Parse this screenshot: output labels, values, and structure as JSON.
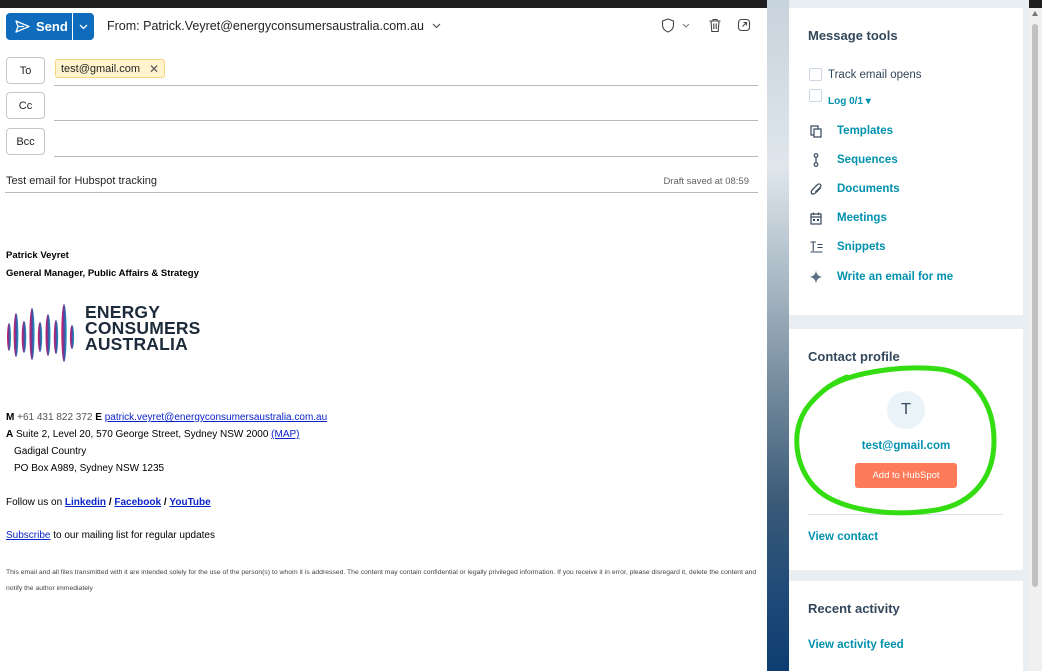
{
  "toolbar": {
    "send_label": "Send",
    "from_label": "From: Patrick.Veyret@energyconsumersaustralia.com.au"
  },
  "recipients": {
    "to_label": "To",
    "cc_label": "Cc",
    "bcc_label": "Bcc",
    "to_chips": [
      "test@gmail.com"
    ]
  },
  "subject": {
    "text": "Test email for Hubspot tracking",
    "draft_status": "Draft saved at 08:59"
  },
  "signature": {
    "name": "Patrick Veyret",
    "role": "General Manager, Public Affairs & Strategy",
    "logo_lines": [
      "ENERGY",
      "CONSUMERS",
      "AUSTRALIA"
    ],
    "phone_prefix": "M",
    "phone": "+61 431 822 372",
    "email_prefix": "E",
    "email": "patrick.veyret@energyconsumersaustralia.com.au",
    "address_prefix": "A",
    "address": "Suite 2, Level 20, 570 George Street, Sydney NSW 2000",
    "map_link": "(MAP)",
    "country": "Gadigal Country",
    "po_box": "PO Box A989, Sydney NSW 1235",
    "follow_text": "Follow us on",
    "social": [
      "Linkedin",
      "Facebook",
      "YouTube"
    ],
    "social_sep": "/",
    "subscribe_link": "Subscribe",
    "subscribe_text": "to our mailing list for regular updates",
    "disclaimer": "This email and all files transmitted with it are intended solely for the use of the person(s) to whom it is addressed. The content may contain confidential or legally privileged information. If you receive it in error, please disregard it, delete the content and notify the author immediately"
  },
  "message_tools": {
    "title": "Message tools",
    "track_label": "Track email opens",
    "log_label": "Log 0/1 ▾",
    "items": [
      {
        "label": "Templates",
        "icon": "templates-icon"
      },
      {
        "label": "Sequences",
        "icon": "sequences-icon"
      },
      {
        "label": "Documents",
        "icon": "paperclip-icon"
      },
      {
        "label": "Meetings",
        "icon": "calendar-icon"
      },
      {
        "label": "Snippets",
        "icon": "snippets-icon"
      },
      {
        "label": "Write an email for me",
        "icon": "sparkle-icon"
      }
    ]
  },
  "contact_profile": {
    "title": "Contact profile",
    "avatar_initial": "T",
    "email": "test@gmail.com",
    "add_button": "Add to HubSpot",
    "view_contact": "View contact"
  },
  "recent_activity": {
    "title": "Recent activity",
    "view_feed": "View activity feed"
  },
  "colors": {
    "send_blue": "#0f6cbd",
    "hubspot_teal": "#0091ae",
    "hubspot_orange": "#ff7a59",
    "annotation_green": "#33dd11",
    "chip_yellow": "#fff4ce"
  }
}
